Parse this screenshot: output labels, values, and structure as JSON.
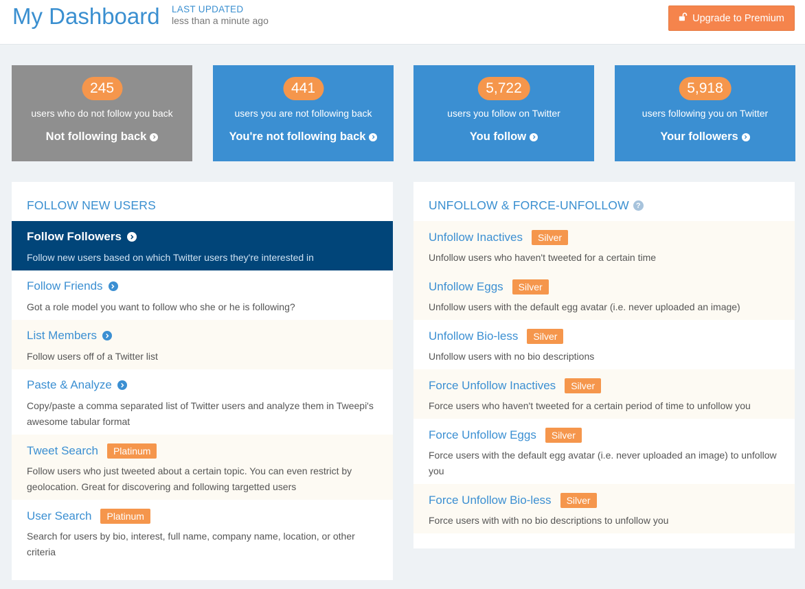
{
  "header": {
    "title": "My Dashboard",
    "updated_label": "LAST UPDATED",
    "updated_value": "less than a minute ago",
    "upgrade_label": "Upgrade to Premium"
  },
  "stats": [
    {
      "count": "245",
      "description": "users who do not follow you back",
      "link": "Not following back"
    },
    {
      "count": "441",
      "description": "users you are not following back",
      "link": "You're not following back"
    },
    {
      "count": "5,722",
      "description": "users you follow on Twitter",
      "link": "You follow"
    },
    {
      "count": "5,918",
      "description": "users following you on Twitter",
      "link": "Your followers"
    }
  ],
  "follow_panel": {
    "title": "FOLLOW NEW USERS",
    "items": [
      {
        "name": "Follow Followers",
        "description": "Follow new users based on which Twitter users they're interested in"
      },
      {
        "name": "Follow Friends",
        "description": "Got a role model you want to follow who she or he is following?"
      },
      {
        "name": "List Members",
        "description": "Follow users off of a Twitter list"
      },
      {
        "name": "Paste & Analyze",
        "description": "Copy/paste a comma separated list of Twitter users and analyze them in Tweepi's awesome tabular format"
      },
      {
        "name": "Tweet Search",
        "tag": "Platinum",
        "description": "Follow users who just tweeted about a certain topic. You can even restrict by geolocation. Great for discovering and following targetted users"
      },
      {
        "name": "User Search",
        "tag": "Platinum",
        "description": "Search for users by bio, interest, full name, company name, location, or other criteria"
      }
    ]
  },
  "unfollow_panel": {
    "title": "UNFOLLOW & FORCE-UNFOLLOW",
    "help_glyph": "?",
    "items": [
      {
        "name": "Unfollow Inactives",
        "tag": "Silver",
        "description": "Unfollow users who haven't tweeted for a certain time"
      },
      {
        "name": "Unfollow Eggs",
        "tag": "Silver",
        "description": "Unfollow users with the default egg avatar (i.e. never uploaded an image)"
      },
      {
        "name": "Unfollow Bio-less",
        "tag": "Silver",
        "description": "Unfollow users with no bio descriptions"
      },
      {
        "name": "Force Unfollow Inactives",
        "tag": "Silver",
        "description": "Force users who haven't tweeted for a certain period of time to unfollow you"
      },
      {
        "name": "Force Unfollow Eggs",
        "tag": "Silver",
        "description": "Force users with the default egg avatar (i.e. never uploaded an image) to unfollow you"
      },
      {
        "name": "Force Unfollow Bio-less",
        "tag": "Silver",
        "description": "Force users with with no bio descriptions to unfollow you"
      }
    ]
  },
  "icons": {
    "upgrade": "unlock-icon",
    "arrow": "chevron-circle-right-icon",
    "help": "question-circle-icon"
  },
  "colors": {
    "brand_blue": "#3b8fd2",
    "active_navy": "#014579",
    "accent_orange": "#f5844c",
    "muted_gray": "#8f8f8f"
  }
}
